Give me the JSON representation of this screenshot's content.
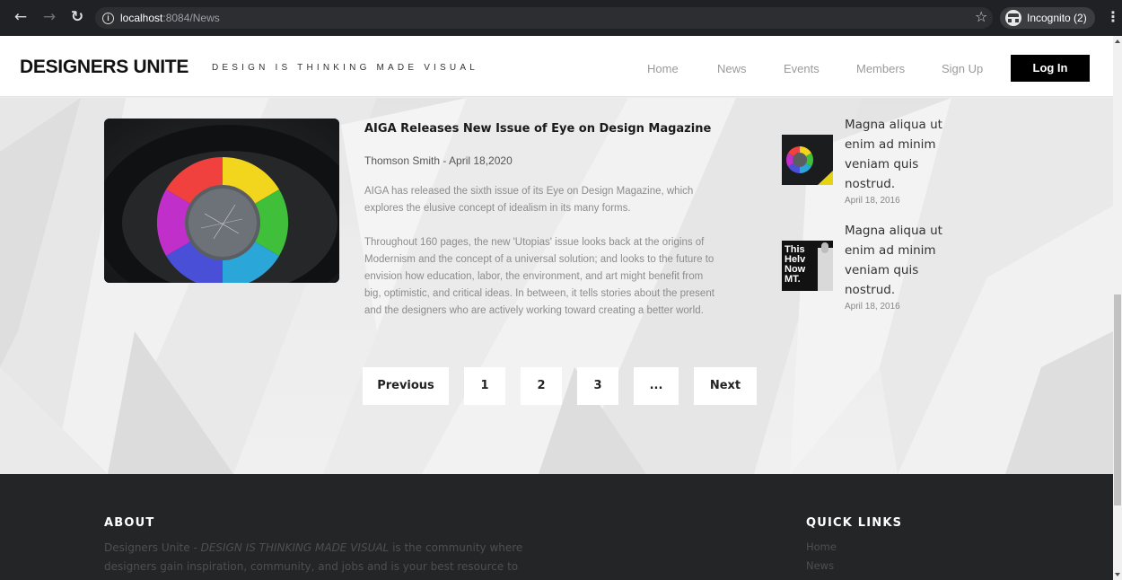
{
  "browser": {
    "url_host": "localhost",
    "url_path": ":8084/News",
    "incognito_label": "Incognito (2)",
    "icons": [
      "back-arrow-icon",
      "forward-arrow-icon",
      "reload-icon",
      "info-icon",
      "star-icon",
      "incognito-icon",
      "menu-dots-icon"
    ]
  },
  "header": {
    "brand": "DESIGNERS UNITE",
    "tagline": "DESIGN IS THINKING MADE VISUAL",
    "nav": [
      "Home",
      "News",
      "Events",
      "Members",
      "Sign Up"
    ],
    "login_label": "Log In"
  },
  "article": {
    "title": "AIGA Releases New Issue of Eye on Design Magazine",
    "meta": "Thomson Smith - April 18,2020",
    "paragraph1": "AIGA has released the sixth issue of its Eye on Design Magazine, which explores the elusive concept of idealism in its many forms.",
    "paragraph2": "Throughout 160 pages, the new 'Utopias' issue looks back at the origins of Modernism and the concept of a universal solution; and looks to the future to envision how education, labor, the environment, and art might benefit from big, optimistic, and critical ideas. In between, it tells stories about the present and the designers who are actively working toward creating a better world."
  },
  "pagination": {
    "previous": "Previous",
    "pages": [
      "1",
      "2",
      "3",
      "..."
    ],
    "next": "Next"
  },
  "sidebar": {
    "posts": [
      {
        "text": "Magna aliqua ut enim ad minim veniam quis nostrud.",
        "date": "April 18, 2016"
      },
      {
        "text": "Magna aliqua ut enim ad minim veniam quis nostrud.",
        "date": "April 18, 2016",
        "thumb_text": "This\nHelv\nNow\nMT."
      }
    ]
  },
  "footer": {
    "about_heading": "ABOUT",
    "about_brand": "Designers Unite",
    "about_sep": " - ",
    "about_tagline": "DESIGN IS THINKING MADE VISUAL",
    "about_rest": " is the community where designers gain inspiration, community, and jobs and is your best resource to",
    "quick_links_heading": "QUICK LINKS",
    "quick_links": [
      "Home",
      "News"
    ]
  },
  "colors": {
    "chrome_bg": "#202124",
    "footer_bg": "#242526",
    "login_bg": "#000000",
    "nav_text": "#9a9a9a"
  }
}
